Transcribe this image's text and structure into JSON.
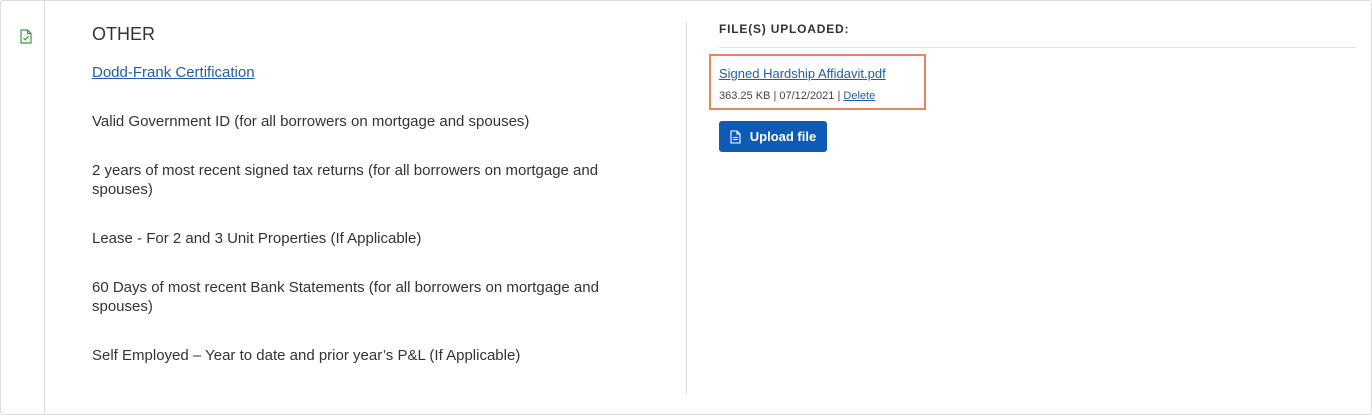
{
  "section": {
    "title": "OTHER",
    "document_link": "Dodd-Frank Certification",
    "requirements": [
      "Valid Government ID (for all borrowers on mortgage and spouses)",
      "2 years of most recent signed tax returns (for all borrowers on mortgage and spouses)",
      "Lease - For 2 and 3 Unit Properties (If Applicable)",
      "60 Days of most recent Bank Statements (for all borrowers on mortgage and spouses)",
      "Self Employed – Year to date and prior year’s P&L (If Applicable)"
    ]
  },
  "uploads": {
    "heading": "FILE(S) UPLOADED:",
    "file": {
      "name": "Signed Hardship Affidavit.pdf",
      "size": "363.25 KB",
      "date": "07/12/2021",
      "separator": "|",
      "delete_label": "Delete"
    },
    "upload_label": "Upload file"
  },
  "icons": {
    "status": "document-check-icon",
    "upload": "document-icon"
  },
  "colors": {
    "link": "#1f5fa6",
    "primary_button": "#0d5bb5",
    "highlight_border": "#e8835c",
    "status_icon": "#3a9b3a"
  }
}
